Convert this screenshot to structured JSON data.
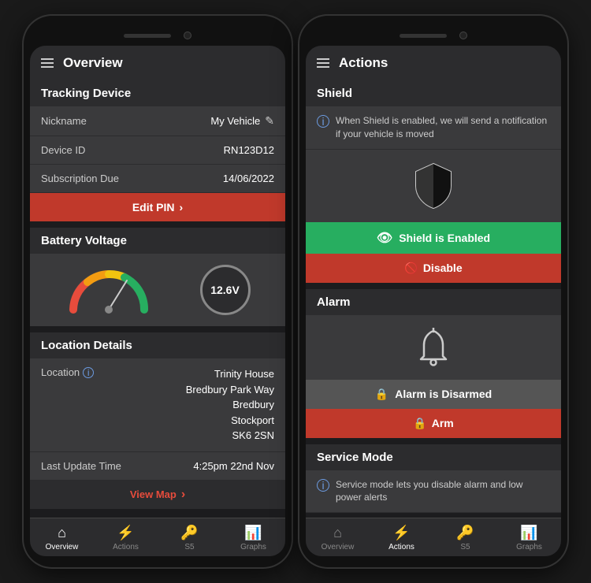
{
  "phone_left": {
    "header": {
      "title": "Overview",
      "menu_icon": "hamburger-icon"
    },
    "tracking_device": {
      "section_title": "Tracking Device",
      "rows": [
        {
          "label": "Nickname",
          "value": "My Vehicle",
          "has_edit": true
        },
        {
          "label": "Device ID",
          "value": "RN123D12"
        },
        {
          "label": "Subscription Due",
          "value": "14/06/2022"
        }
      ],
      "edit_pin_label": "Edit PIN",
      "edit_pin_chevron": "›"
    },
    "battery_voltage": {
      "section_title": "Battery Voltage",
      "value": "12.6V"
    },
    "location_details": {
      "section_title": "Location Details",
      "rows": [
        {
          "label": "Location",
          "value": "Trinity House\nBredbury Park Way\nBredbury\nStockport\nSK6 2SN",
          "has_info": true
        },
        {
          "label": "Last Update Time",
          "value": "4:25pm 22nd Nov"
        }
      ],
      "view_map_label": "View Map",
      "view_map_chevron": "›"
    },
    "bottom_nav": [
      {
        "label": "Overview",
        "icon": "home-icon",
        "active": true
      },
      {
        "label": "Actions",
        "icon": "bolt-icon",
        "active": false
      },
      {
        "label": "S5",
        "icon": "key-icon",
        "active": false
      },
      {
        "label": "Graphs",
        "icon": "graph-icon",
        "active": false
      }
    ]
  },
  "phone_right": {
    "header": {
      "title": "Actions",
      "menu_icon": "hamburger-icon"
    },
    "shield": {
      "section_title": "Shield",
      "info_text": "When Shield is enabled, we will send a notification if your vehicle is moved",
      "enabled_label": "Shield is Enabled",
      "disable_label": "Disable",
      "eye_icon": "eye-icon",
      "no_eye_icon": "eye-slash-icon"
    },
    "alarm": {
      "section_title": "Alarm",
      "disarmed_label": "Alarm is Disarmed",
      "arm_label": "Arm",
      "lock_icon": "lock-icon"
    },
    "service_mode": {
      "section_title": "Service Mode",
      "info_text": "Service mode lets you disable alarm and low power alerts"
    },
    "bottom_nav": [
      {
        "label": "Overview",
        "icon": "home-icon",
        "active": false
      },
      {
        "label": "Actions",
        "icon": "bolt-icon",
        "active": true
      },
      {
        "label": "S5",
        "icon": "key-icon",
        "active": false
      },
      {
        "label": "Graphs",
        "icon": "graph-icon",
        "active": false
      }
    ]
  }
}
